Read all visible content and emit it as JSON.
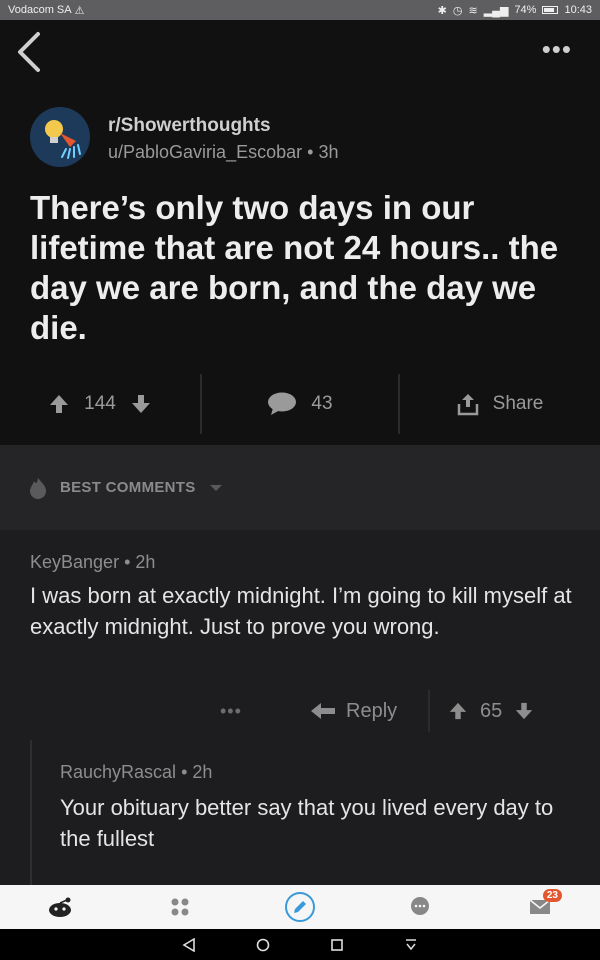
{
  "status": {
    "carrier": "Vodacom SA",
    "battery": "74%",
    "time": "10:43"
  },
  "post": {
    "subreddit": "r/Showerthoughts",
    "author": "u/PabloGaviria_Escobar",
    "age": "3h",
    "title": "There’s only two days in our lifetime that are not 24 hours.. the day we are born, and the day we die.",
    "score": "144",
    "comments_count": "43",
    "share_label": "Share"
  },
  "sort": {
    "label": "BEST COMMENTS"
  },
  "comments": [
    {
      "author": "KeyBanger",
      "age": "2h",
      "body": "I was born at exactly midnight. I’m going to kill myself at exactly midnight. Just to prove you wrong.",
      "reply_label": "Reply",
      "score": "65"
    },
    {
      "author": "RauchyRascal",
      "age": "2h",
      "body": "Your obituary better say that you lived every day to the fullest"
    }
  ],
  "nav": {
    "inbox_badge": "23"
  },
  "colors": {
    "post_bg": "#111112",
    "comment_bg": "#1d1d1f",
    "accent_badge": "#e4572e"
  }
}
